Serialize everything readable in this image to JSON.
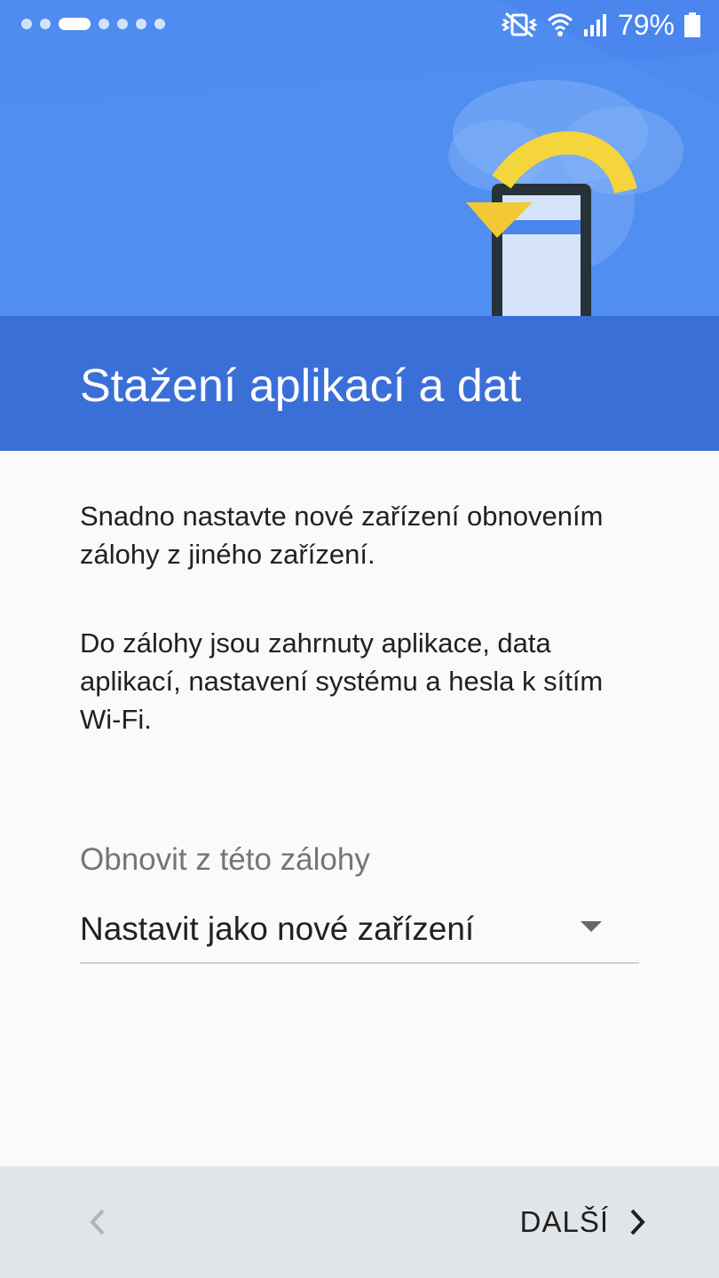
{
  "status_bar": {
    "battery_percent": "79%",
    "icons": [
      "vibrate-off-icon",
      "wifi-icon",
      "signal-icon",
      "battery-icon"
    ],
    "page_dots_count": 7,
    "active_dot_index": 2
  },
  "header": {
    "title": "Stažení aplikací a dat",
    "illustration": "phone-backup-restore-illustration",
    "colors": {
      "sky": "#4a86ee",
      "band": "#3b6fd8",
      "arrow": "#f4d53c"
    }
  },
  "body": {
    "paragraph1": "Snadno nastavte nové zařízení obnovením zálohy z jiného zařízení.",
    "paragraph2": "Do zálohy jsou zahrnuty aplikace, data aplikací, nastavení systému a hesla k sítím Wi-Fi."
  },
  "restore": {
    "label": "Obnovit z této zálohy",
    "selected_value": "Nastavit jako nové zařízení"
  },
  "footer": {
    "back_icon": "chevron-left-icon",
    "next_label": "DALŠÍ",
    "next_icon": "chevron-right-icon"
  }
}
